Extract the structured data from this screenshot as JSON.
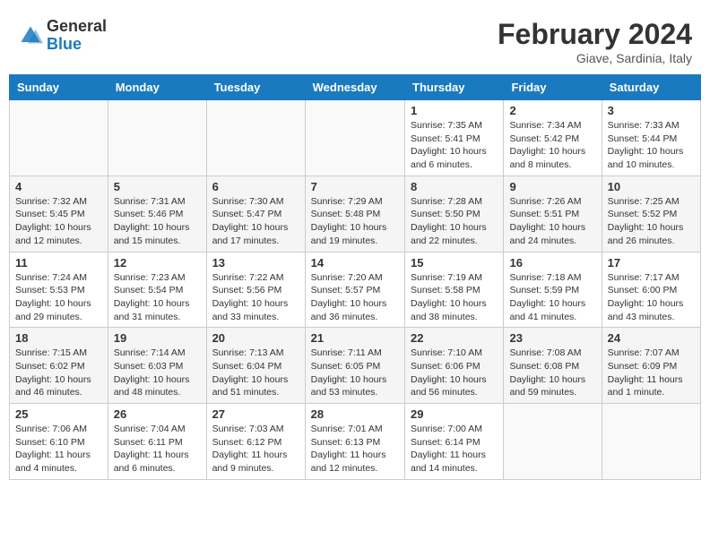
{
  "header": {
    "logo_general": "General",
    "logo_blue": "Blue",
    "title": "February 2024",
    "location": "Giave, Sardinia, Italy"
  },
  "days_of_week": [
    "Sunday",
    "Monday",
    "Tuesday",
    "Wednesday",
    "Thursday",
    "Friday",
    "Saturday"
  ],
  "weeks": [
    [
      {
        "day": "",
        "info": ""
      },
      {
        "day": "",
        "info": ""
      },
      {
        "day": "",
        "info": ""
      },
      {
        "day": "",
        "info": ""
      },
      {
        "day": "1",
        "info": "Sunrise: 7:35 AM\nSunset: 5:41 PM\nDaylight: 10 hours and 6 minutes."
      },
      {
        "day": "2",
        "info": "Sunrise: 7:34 AM\nSunset: 5:42 PM\nDaylight: 10 hours and 8 minutes."
      },
      {
        "day": "3",
        "info": "Sunrise: 7:33 AM\nSunset: 5:44 PM\nDaylight: 10 hours and 10 minutes."
      }
    ],
    [
      {
        "day": "4",
        "info": "Sunrise: 7:32 AM\nSunset: 5:45 PM\nDaylight: 10 hours and 12 minutes."
      },
      {
        "day": "5",
        "info": "Sunrise: 7:31 AM\nSunset: 5:46 PM\nDaylight: 10 hours and 15 minutes."
      },
      {
        "day": "6",
        "info": "Sunrise: 7:30 AM\nSunset: 5:47 PM\nDaylight: 10 hours and 17 minutes."
      },
      {
        "day": "7",
        "info": "Sunrise: 7:29 AM\nSunset: 5:48 PM\nDaylight: 10 hours and 19 minutes."
      },
      {
        "day": "8",
        "info": "Sunrise: 7:28 AM\nSunset: 5:50 PM\nDaylight: 10 hours and 22 minutes."
      },
      {
        "day": "9",
        "info": "Sunrise: 7:26 AM\nSunset: 5:51 PM\nDaylight: 10 hours and 24 minutes."
      },
      {
        "day": "10",
        "info": "Sunrise: 7:25 AM\nSunset: 5:52 PM\nDaylight: 10 hours and 26 minutes."
      }
    ],
    [
      {
        "day": "11",
        "info": "Sunrise: 7:24 AM\nSunset: 5:53 PM\nDaylight: 10 hours and 29 minutes."
      },
      {
        "day": "12",
        "info": "Sunrise: 7:23 AM\nSunset: 5:54 PM\nDaylight: 10 hours and 31 minutes."
      },
      {
        "day": "13",
        "info": "Sunrise: 7:22 AM\nSunset: 5:56 PM\nDaylight: 10 hours and 33 minutes."
      },
      {
        "day": "14",
        "info": "Sunrise: 7:20 AM\nSunset: 5:57 PM\nDaylight: 10 hours and 36 minutes."
      },
      {
        "day": "15",
        "info": "Sunrise: 7:19 AM\nSunset: 5:58 PM\nDaylight: 10 hours and 38 minutes."
      },
      {
        "day": "16",
        "info": "Sunrise: 7:18 AM\nSunset: 5:59 PM\nDaylight: 10 hours and 41 minutes."
      },
      {
        "day": "17",
        "info": "Sunrise: 7:17 AM\nSunset: 6:00 PM\nDaylight: 10 hours and 43 minutes."
      }
    ],
    [
      {
        "day": "18",
        "info": "Sunrise: 7:15 AM\nSunset: 6:02 PM\nDaylight: 10 hours and 46 minutes."
      },
      {
        "day": "19",
        "info": "Sunrise: 7:14 AM\nSunset: 6:03 PM\nDaylight: 10 hours and 48 minutes."
      },
      {
        "day": "20",
        "info": "Sunrise: 7:13 AM\nSunset: 6:04 PM\nDaylight: 10 hours and 51 minutes."
      },
      {
        "day": "21",
        "info": "Sunrise: 7:11 AM\nSunset: 6:05 PM\nDaylight: 10 hours and 53 minutes."
      },
      {
        "day": "22",
        "info": "Sunrise: 7:10 AM\nSunset: 6:06 PM\nDaylight: 10 hours and 56 minutes."
      },
      {
        "day": "23",
        "info": "Sunrise: 7:08 AM\nSunset: 6:08 PM\nDaylight: 10 hours and 59 minutes."
      },
      {
        "day": "24",
        "info": "Sunrise: 7:07 AM\nSunset: 6:09 PM\nDaylight: 11 hours and 1 minute."
      }
    ],
    [
      {
        "day": "25",
        "info": "Sunrise: 7:06 AM\nSunset: 6:10 PM\nDaylight: 11 hours and 4 minutes."
      },
      {
        "day": "26",
        "info": "Sunrise: 7:04 AM\nSunset: 6:11 PM\nDaylight: 11 hours and 6 minutes."
      },
      {
        "day": "27",
        "info": "Sunrise: 7:03 AM\nSunset: 6:12 PM\nDaylight: 11 hours and 9 minutes."
      },
      {
        "day": "28",
        "info": "Sunrise: 7:01 AM\nSunset: 6:13 PM\nDaylight: 11 hours and 12 minutes."
      },
      {
        "day": "29",
        "info": "Sunrise: 7:00 AM\nSunset: 6:14 PM\nDaylight: 11 hours and 14 minutes."
      },
      {
        "day": "",
        "info": ""
      },
      {
        "day": "",
        "info": ""
      }
    ]
  ]
}
